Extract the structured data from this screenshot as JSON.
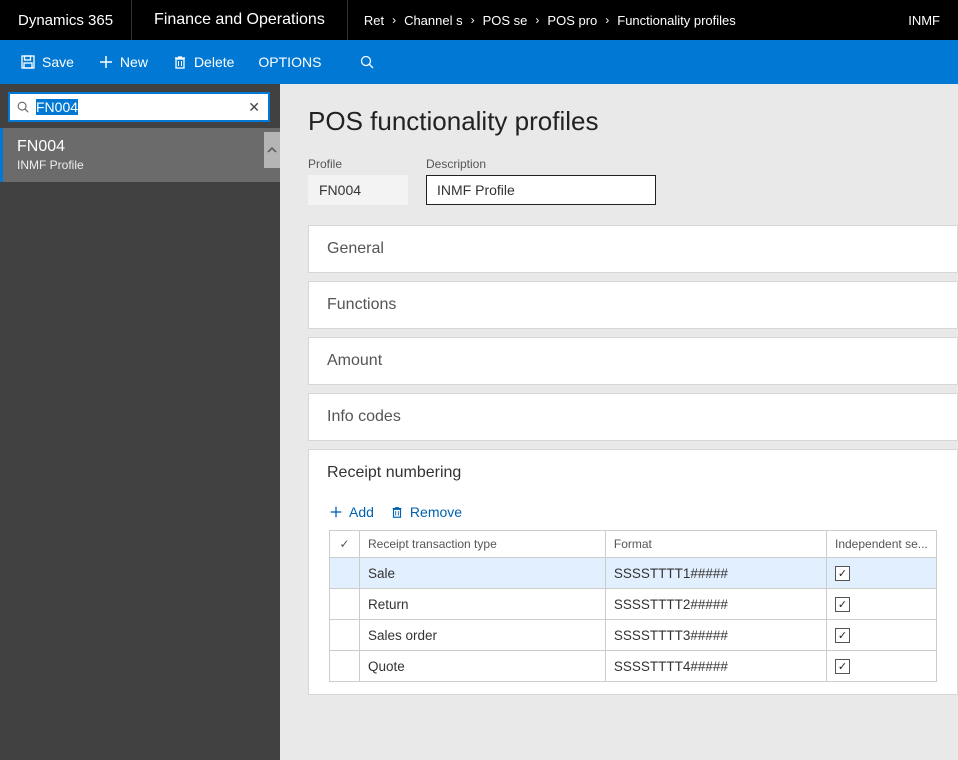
{
  "topbar": {
    "brand": "Dynamics 365",
    "module": "Finance and Operations",
    "crumbs": [
      "Ret",
      "Channel s",
      "POS se",
      "POS pro",
      "Functionality profiles"
    ],
    "entity": "INMF"
  },
  "cmd": {
    "save": "Save",
    "new": "New",
    "delete": "Delete",
    "options": "OPTIONS"
  },
  "sidebar": {
    "search_value": "FN004",
    "item": {
      "title": "FN004",
      "sub": "INMF Profile"
    }
  },
  "page": {
    "title": "POS functionality profiles",
    "profile_label": "Profile",
    "profile_value": "FN004",
    "desc_label": "Description",
    "desc_value": "INMF Profile"
  },
  "tabs": {
    "general": "General",
    "functions": "Functions",
    "amount": "Amount",
    "info_codes": "Info codes",
    "receipt": "Receipt numbering"
  },
  "receipt": {
    "add": "Add",
    "remove": "Remove",
    "cols": {
      "type": "Receipt transaction type",
      "format": "Format",
      "indep": "Independent se..."
    },
    "rows": [
      {
        "type": "Sale",
        "format": "SSSSTTTT1#####",
        "indep": true,
        "selected": true
      },
      {
        "type": "Return",
        "format": "SSSSTTTT2#####",
        "indep": true,
        "selected": false
      },
      {
        "type": "Sales order",
        "format": "SSSSTTTT3#####",
        "indep": true,
        "selected": false
      },
      {
        "type": "Quote",
        "format": "SSSSTTTT4#####",
        "indep": true,
        "selected": false
      }
    ]
  }
}
